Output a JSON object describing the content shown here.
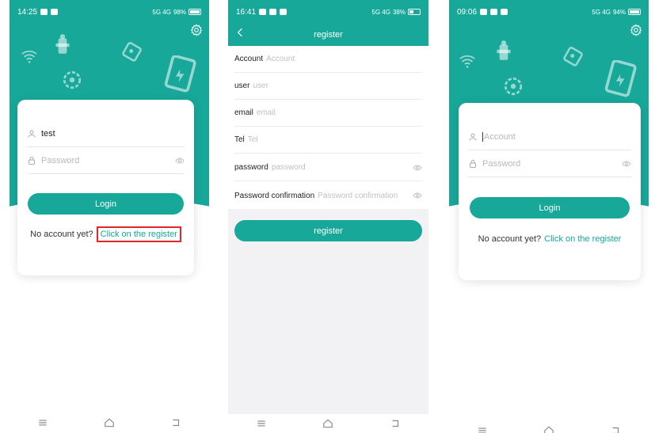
{
  "brand_color": "#17a899",
  "login1": {
    "status": {
      "time": "14:25",
      "signal": "5G 4G",
      "battery": "98%"
    },
    "username_value": "test",
    "password_placeholder": "Password",
    "login_label": "Login",
    "no_account": "No account yet?",
    "register_link": "Click on the register"
  },
  "register": {
    "status": {
      "time": "16:41",
      "signal": "5G 4G",
      "battery": "38%"
    },
    "title": "register",
    "fields": [
      {
        "label": "Account",
        "placeholder": "Account"
      },
      {
        "label": "user",
        "placeholder": "user"
      },
      {
        "label": "email",
        "placeholder": "email"
      },
      {
        "label": "Tel",
        "placeholder": "Tel"
      },
      {
        "label": "password",
        "placeholder": "password"
      },
      {
        "label": "Password confirmation",
        "placeholder": "Password confirmation"
      }
    ],
    "submit_label": "register"
  },
  "login3": {
    "status": {
      "time": "09:06",
      "signal": "5G 4G",
      "battery": "94%"
    },
    "account_placeholder": "Account",
    "password_placeholder": "Password",
    "login_label": "Login",
    "no_account": "No account yet?",
    "register_link": "Click on the register"
  },
  "icons": [
    "gear-icon",
    "user-icon",
    "lock-icon",
    "eye-icon",
    "back-icon",
    "menu-icon",
    "home-icon",
    "return-icon"
  ]
}
